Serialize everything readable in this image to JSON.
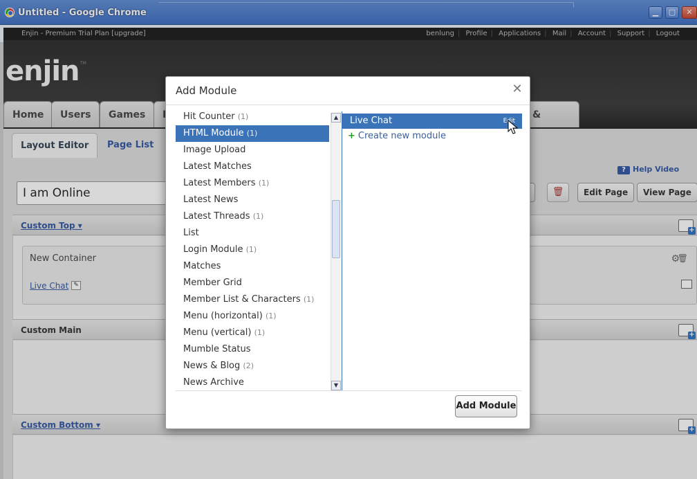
{
  "window": {
    "title": "Untitled - Google Chrome",
    "min": "▁",
    "max": "▢",
    "close": "✕"
  },
  "sitebar": {
    "left": "Enjin - Premium Trial Plan [upgrade]",
    "links": [
      "benlung",
      "Profile",
      "Applications",
      "Mail",
      "Account",
      "Support",
      "Logout"
    ]
  },
  "logo": "enjin",
  "logo_tm": "TM",
  "nav_tabs": [
    "Home",
    "Users",
    "Games",
    "P",
    "& Pricing"
  ],
  "sub_tabs": [
    "Layout Editor",
    "Page List"
  ],
  "help_video": "Help Video",
  "page_name_value": "I am Online",
  "buttons": {
    "edit_page": "Edit Page",
    "view_page": "View Page"
  },
  "sections": {
    "custom_top": "Custom Top ▾",
    "custom_main": "Custom Main",
    "custom_bottom": "Custom Bottom ▾"
  },
  "container": {
    "title": "New Container",
    "module_link": "Live Chat"
  },
  "modal": {
    "title": "Add Module",
    "close": "✕",
    "modules": [
      {
        "name": "Hit Counter",
        "count": "(1)"
      },
      {
        "name": "HTML Module",
        "count": "(1)"
      },
      {
        "name": "Image Upload",
        "count": ""
      },
      {
        "name": "Latest Matches",
        "count": ""
      },
      {
        "name": "Latest Members",
        "count": "(1)"
      },
      {
        "name": "Latest News",
        "count": ""
      },
      {
        "name": "Latest Threads",
        "count": "(1)"
      },
      {
        "name": "List",
        "count": ""
      },
      {
        "name": "Login Module",
        "count": "(1)"
      },
      {
        "name": "Matches",
        "count": ""
      },
      {
        "name": "Member Grid",
        "count": ""
      },
      {
        "name": "Member List & Characters",
        "count": "(1)"
      },
      {
        "name": "Menu (horizontal)",
        "count": "(1)"
      },
      {
        "name": "Menu (vertical)",
        "count": "(1)"
      },
      {
        "name": "Mumble Status",
        "count": ""
      },
      {
        "name": "News & Blog",
        "count": "(2)"
      },
      {
        "name": "News Archive",
        "count": ""
      }
    ],
    "selected_module": "HTML Module",
    "instance": {
      "name": "Live Chat",
      "edit": "Edit"
    },
    "create_new": "Create new module",
    "add_button": "Add Module"
  }
}
